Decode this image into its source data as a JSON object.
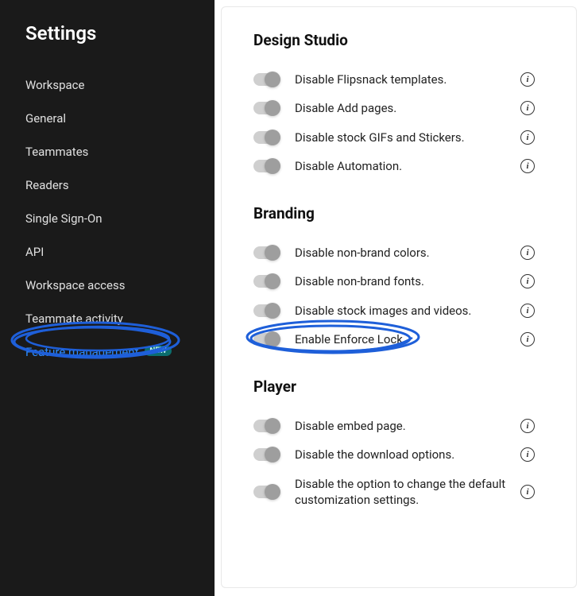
{
  "sidebar": {
    "title": "Settings",
    "items": [
      {
        "label": "Workspace"
      },
      {
        "label": "General"
      },
      {
        "label": "Teammates"
      },
      {
        "label": "Readers"
      },
      {
        "label": "Single Sign-On"
      },
      {
        "label": "API"
      },
      {
        "label": "Workspace access"
      },
      {
        "label": "Teammate activity"
      },
      {
        "label": "Feature management",
        "badge": "NEW",
        "highlighted": true
      }
    ]
  },
  "sections": [
    {
      "title": "Design Studio",
      "toggles": [
        {
          "label": "Disable Flipsnack templates."
        },
        {
          "label": "Disable Add pages."
        },
        {
          "label": "Disable stock GIFs and Stickers."
        },
        {
          "label": "Disable Automation."
        }
      ]
    },
    {
      "title": "Branding",
      "toggles": [
        {
          "label": "Disable non-brand colors."
        },
        {
          "label": "Disable non-brand fonts."
        },
        {
          "label": "Disable stock images and videos."
        },
        {
          "label": "Enable Enforce Lock.",
          "annotated": true
        }
      ]
    },
    {
      "title": "Player",
      "toggles": [
        {
          "label": "Disable embed page."
        },
        {
          "label": "Disable the download options."
        },
        {
          "label": "Disable the option to change the default customization settings."
        }
      ]
    }
  ],
  "info_glyph": "i"
}
